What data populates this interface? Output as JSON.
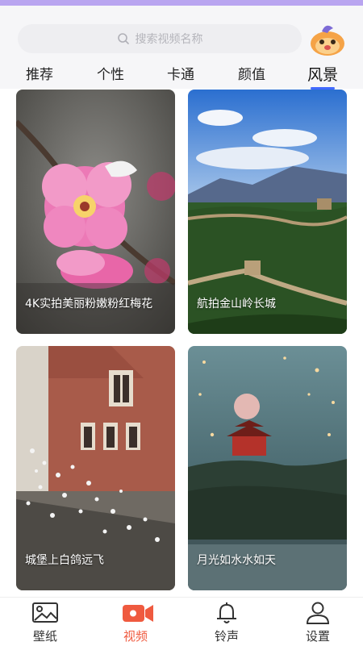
{
  "search": {
    "placeholder": "搜索视频名称"
  },
  "tabs": [
    {
      "label": "推荐"
    },
    {
      "label": "个性"
    },
    {
      "label": "卡通"
    },
    {
      "label": "颜值"
    },
    {
      "label": "风景",
      "active": true
    }
  ],
  "videos": [
    {
      "title": "4K实拍美丽粉嫩粉红梅花"
    },
    {
      "title": "航拍金山岭长城"
    },
    {
      "title": "城堡上白鸽远飞"
    },
    {
      "title": "月光如水水如天"
    }
  ],
  "nav": [
    {
      "label": "壁纸",
      "icon": "image-icon"
    },
    {
      "label": "视频",
      "icon": "video-camera-icon",
      "active": true
    },
    {
      "label": "铃声",
      "icon": "bell-icon"
    },
    {
      "label": "设置",
      "icon": "user-icon"
    }
  ],
  "colors": {
    "accent_tab": "#4169ff",
    "active_nav": "#ef5a3f",
    "top_bar": "#b9a5f0"
  }
}
